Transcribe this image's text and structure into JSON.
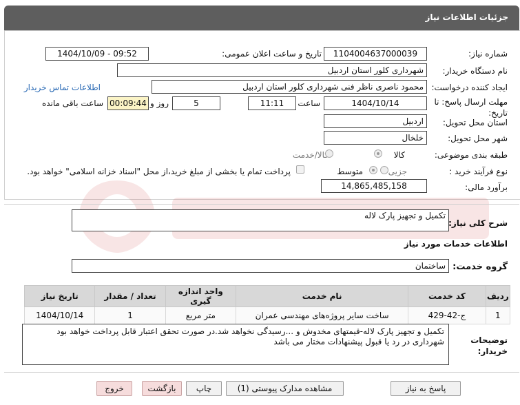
{
  "title": "جزئیات اطلاعات نیاز",
  "fields": {
    "need_number_label": "شماره نیاز:",
    "need_number": "1104004637000039",
    "announce_label": "تاریخ و ساعت اعلان عمومی:",
    "announce_value": "1404/10/09 - 09:52",
    "buyer_org_label": "نام دستگاه خریدار:",
    "buyer_org": "شهرداری کلور استان اردبیل",
    "requester_label": "ایجاد کننده درخواست:",
    "requester": "محمود  ناصری  ناظر فنی  شهرداری کلور استان اردبیل",
    "contact_link": "اطلاعات تماس خریدار",
    "deadline_label_1": "مهلت ارسال پاسخ: تا",
    "deadline_label_2": "تاریخ:",
    "deadline_date": "1404/10/14",
    "time_label": "ساعت",
    "deadline_time": "11:11",
    "days_value": "5",
    "days_label": "روز و",
    "remaining_value": "00:09:44",
    "remaining_label": "ساعت باقی مانده",
    "province_label": "استان محل تحویل:",
    "province": "اردبیل",
    "city_label": "شهر محل تحویل:",
    "city": "خلخال",
    "category_label": "طبقه بندی موضوعی:",
    "category_options": [
      "کالا",
      "کالا/خدمت"
    ],
    "process_label": "نوع فرآیند خرید :",
    "process_options": [
      "جزیی",
      "متوسط"
    ],
    "payment_note": "پرداخت تمام یا بخشی از مبلغ خرید،از محل \"اسناد خزانه اسلامی\" خواهد بود.",
    "budget_label": "برآورد مالی:",
    "budget": "14,865,485,158"
  },
  "summary": {
    "label": "شرح کلی نیاز:",
    "value": "تکمیل و تجهیز پارک لاله"
  },
  "services": {
    "heading": "اطلاعات خدمات مورد نیاز",
    "group_label": "گروه خدمت:",
    "group_value": "ساختمان"
  },
  "table": {
    "headers": [
      "ردیف",
      "کد خدمت",
      "نام خدمت",
      "واحد اندازه گیری",
      "تعداد / مقدار",
      "تاریخ نیاز"
    ],
    "rows": [
      [
        "1",
        "ج-42-429",
        "ساخت سایر پروژه‌های مهندسی عمران",
        "متر مربع",
        "1",
        "1404/10/14"
      ]
    ]
  },
  "notes": {
    "label_1": "توضیحات",
    "label_2": "خریدار:",
    "text": "تکمیل و تجهیز پارک لاله-قیمتهای مخدوش و ...رسیدگی نخواهد شد.در صورت تحقق اعتبار قابل پرداخت خواهد بود شهرداری در رد یا قبول پیشنهادات مختار می باشد"
  },
  "buttons": {
    "reply": "پاسخ به نیاز",
    "attachments": "مشاهده مدارک پیوستی (1)",
    "print": "چاپ",
    "back": "بازگشت",
    "exit": "خروج"
  },
  "colors": {
    "titlebar": "#5e5e5e",
    "remaining_bg": "#fbf4c6",
    "link": "#2a6ab5"
  }
}
